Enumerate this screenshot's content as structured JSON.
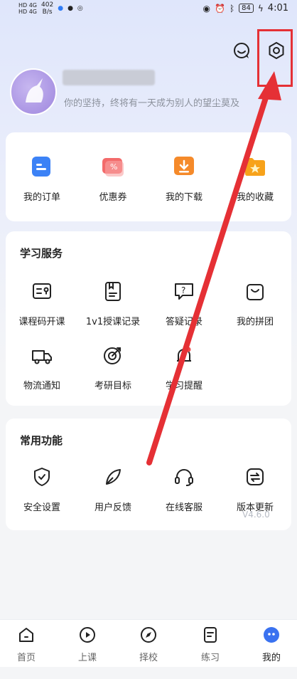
{
  "status_bar": {
    "net_speed": "402",
    "net_speed_unit": "B/s",
    "battery": "84",
    "time": "4:01"
  },
  "profile": {
    "motto": "你的坚持，终将有一天成为别人的望尘莫及"
  },
  "quick_actions": [
    {
      "label": "我的订单",
      "icon": "order-icon",
      "color": "#3c82f6"
    },
    {
      "label": "优惠券",
      "icon": "coupon-icon",
      "color": "#f36b6b"
    },
    {
      "label": "我的下载",
      "icon": "download-icon",
      "color": "#f58a2a"
    },
    {
      "label": "我的收藏",
      "icon": "favorite-icon",
      "color": "#f7a21a"
    }
  ],
  "learning": {
    "title": "学习服务",
    "items": [
      {
        "label": "课程码开课",
        "icon": "course-code-icon"
      },
      {
        "label": "1v1授课记录",
        "icon": "lesson-record-icon"
      },
      {
        "label": "答疑记录",
        "icon": "qa-record-icon"
      },
      {
        "label": "我的拼团",
        "icon": "group-buy-icon"
      },
      {
        "label": "物流通知",
        "icon": "logistics-icon"
      },
      {
        "label": "考研目标",
        "icon": "target-icon"
      },
      {
        "label": "学习提醒",
        "icon": "reminder-icon"
      }
    ]
  },
  "common": {
    "title": "常用功能",
    "items": [
      {
        "label": "安全设置",
        "icon": "shield-icon"
      },
      {
        "label": "用户反馈",
        "icon": "feedback-icon"
      },
      {
        "label": "在线客服",
        "icon": "headset-icon"
      },
      {
        "label": "版本更新",
        "icon": "update-icon"
      }
    ],
    "version": "V4.6.0"
  },
  "tabs": [
    {
      "label": "首页",
      "icon": "home-icon"
    },
    {
      "label": "上课",
      "icon": "play-icon"
    },
    {
      "label": "择校",
      "icon": "compass-icon"
    },
    {
      "label": "练习",
      "icon": "practice-icon"
    },
    {
      "label": "我的",
      "icon": "profile-icon",
      "active": true
    }
  ],
  "colors": {
    "accent": "#3a72f0",
    "annotation": "#e53035"
  }
}
